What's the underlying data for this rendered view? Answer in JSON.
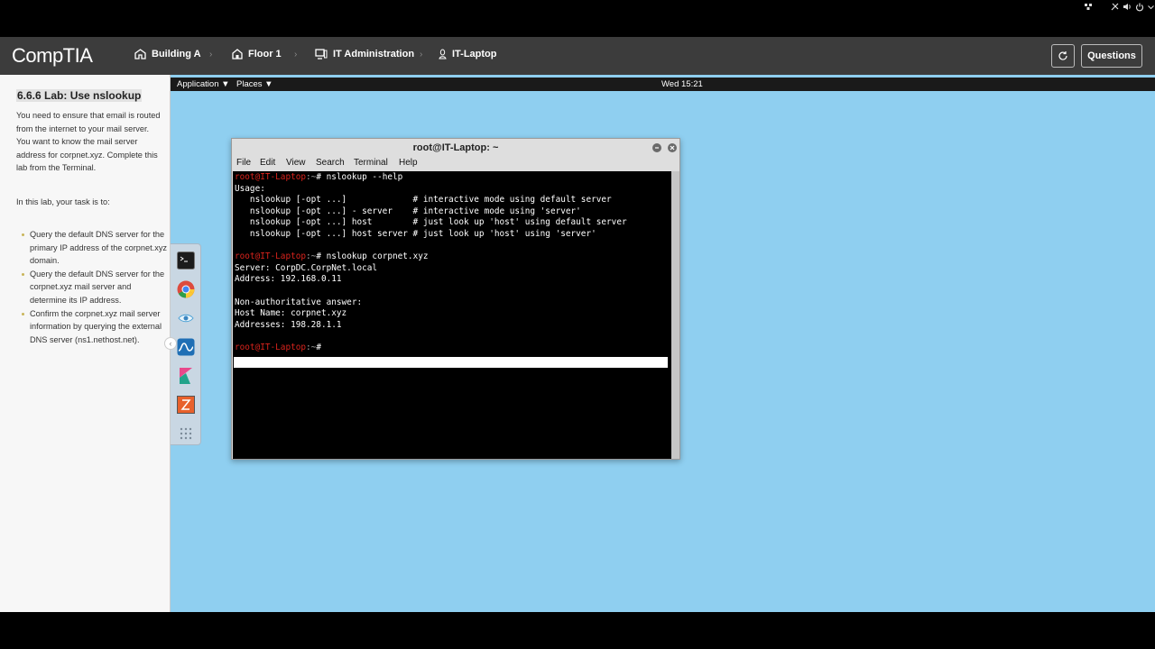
{
  "header": {
    "logo": "CompTIA",
    "breadcrumbs": [
      {
        "label": "Building A",
        "icon": "building-icon"
      },
      {
        "label": "Floor 1",
        "icon": "floor-icon"
      },
      {
        "label": "IT Administration",
        "icon": "computer-icon"
      },
      {
        "label": "IT-Laptop",
        "icon": "linux-icon"
      }
    ],
    "separator": "›",
    "questions_label": "Questions"
  },
  "lab": {
    "title": "6.6.6 Lab: Use nslookup",
    "intro": "You need to ensure that email is routed from the internet to your mail server. You want to know the mail server address for corpnet.xyz. Complete this lab from the Terminal.",
    "task_intro": "In this lab, your task is to:",
    "tasks": [
      "Query the default DNS server for the primary IP address of the corpnet.xyz domain.",
      "Query the default DNS server for the corpnet.xyz mail server and determine its IP address.",
      "Confirm the corpnet.xyz mail server information by querying the external DNS server (ns1.nethost.net)."
    ]
  },
  "topbar": {
    "application": "Application ▼",
    "places": "Places ▼",
    "clock": "Wed 15:21"
  },
  "dock": {
    "items": [
      "terminal-icon",
      "chrome-icon",
      "eye-icon",
      "wireshark-icon",
      "kibana-icon",
      "burp-icon",
      "app-grid-icon"
    ]
  },
  "terminal": {
    "title": "root@IT-Laptop: ~",
    "menu": [
      "File",
      "Edit",
      "View",
      "Search",
      "Terminal",
      "Help"
    ],
    "prompt_user": "root@IT-Laptop",
    "prompt_path": ":~",
    "prompt_symbol": "#",
    "cmd1": " nslookup --help",
    "usage": "Usage:",
    "usage_lines": [
      "   nslookup [-opt ...]             # interactive mode using default server",
      "   nslookup [-opt ...] - server    # interactive mode using 'server'",
      "   nslookup [-opt ...] host        # just look up 'host' using default server",
      "   nslookup [-opt ...] host server # just look up 'host' using 'server'"
    ],
    "cmd2": " nslookup corpnet.xyz",
    "server_line": "Server: CorpDC.CorpNet.local",
    "address_line": "Address: 192.168.0.11",
    "nonauth": "Non-authoritative answer:",
    "hostname_line": "Host Name: corpnet.xyz",
    "addresses_line": "Addresses: 198.28.1.1",
    "cmd3": ""
  }
}
